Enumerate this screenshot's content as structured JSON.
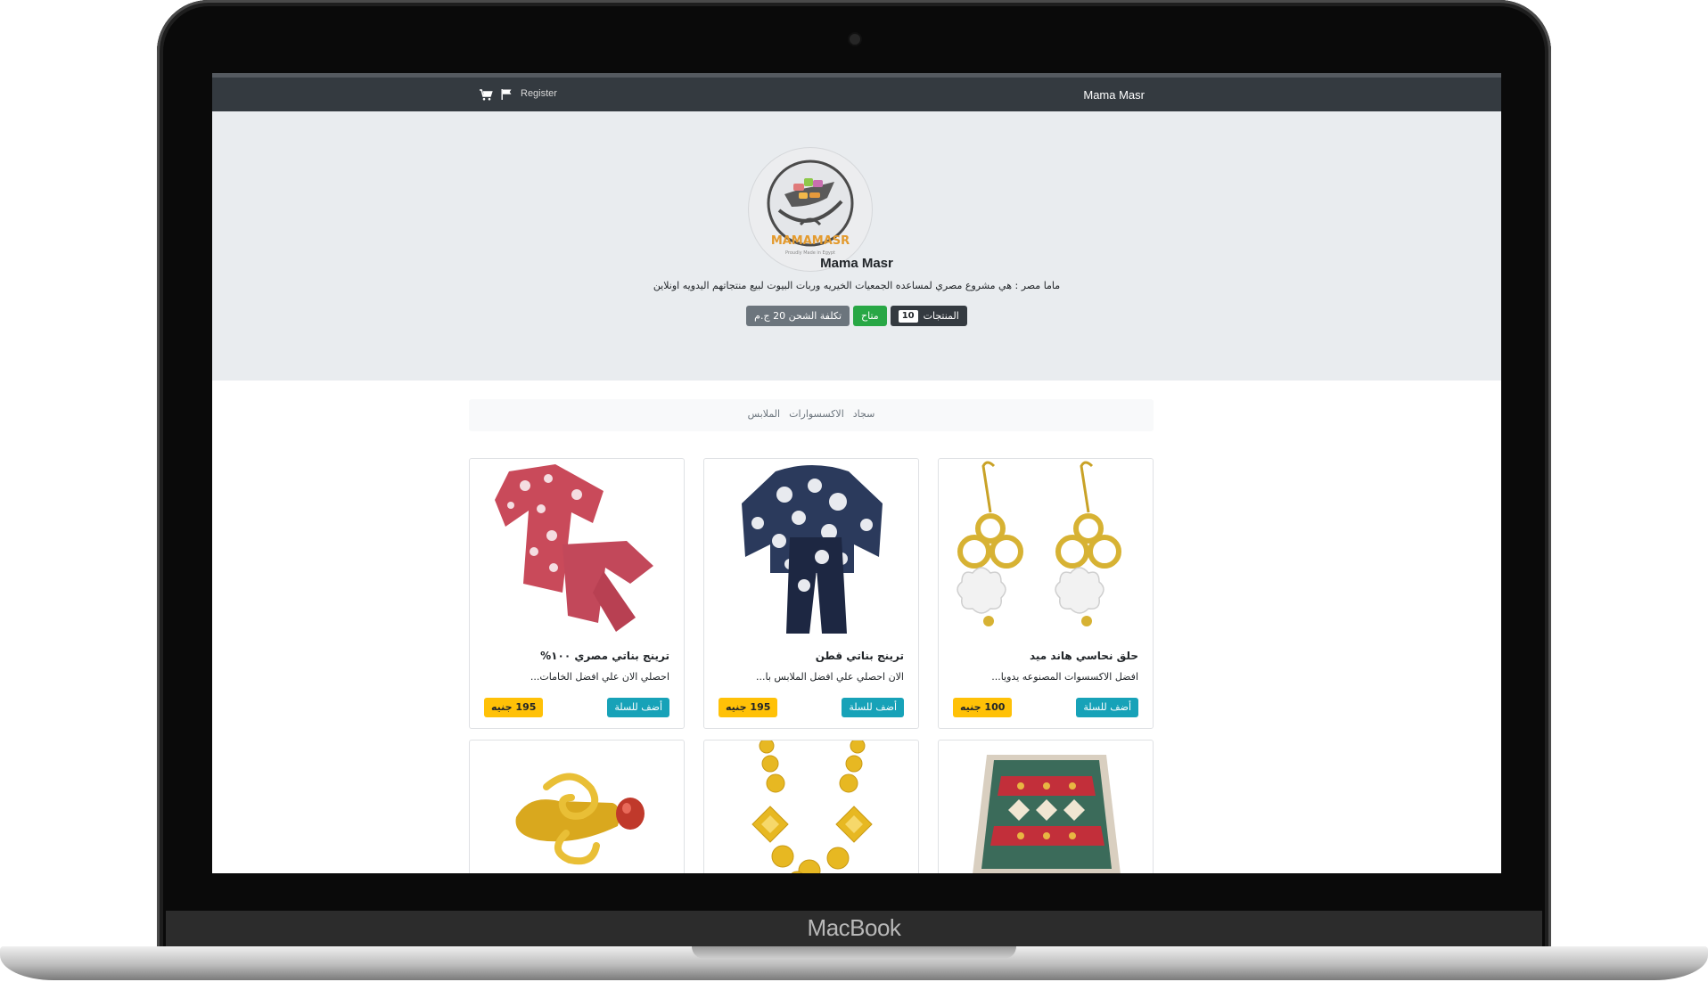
{
  "device": {
    "brand": "MacBook"
  },
  "navbar": {
    "brand": "Mama Masr",
    "register": "Register",
    "icons": [
      "cart-icon",
      "flag-icon"
    ]
  },
  "hero": {
    "logo_text": "MAMAMASR",
    "logo_tagline": "Proudly Made in Egypt",
    "title": "Mama Masr",
    "description": "ماما مصر : هي مشروع مصري لمساعده الجمعيات الخيريه وربات البيوت لبيع منتجاتهم اليدويه اونلاين",
    "badges": {
      "products_label": "المنتجات",
      "products_count": "10",
      "status": "متاح",
      "shipping": "تكلفة الشحن 20 ج.م"
    }
  },
  "categories": [
    "سجاد",
    "الاكسسوارات",
    "الملابس"
  ],
  "products": [
    {
      "title": "حلق نحاسي هاند ميد",
      "desc": "افضل الاكسسوات المصنوعه يدويا...",
      "add": "أضف للسلة",
      "price": "100 جنيه",
      "image": "earrings"
    },
    {
      "title": "ترينج بناتي قطن",
      "desc": "الان احصلي علي افضل الملابس با...",
      "add": "أضف للسلة",
      "price": "195 جنيه",
      "image": "navy-pajama"
    },
    {
      "title": "ترينج بناتي مصري ١٠٠%",
      "desc": "احصلي الان علي افضل الخامات...",
      "add": "أضف للسلة",
      "price": "195 جنيه",
      "image": "pink-pajama"
    },
    {
      "image": "rug"
    },
    {
      "image": "gold-necklace"
    },
    {
      "image": "gold-ring"
    }
  ],
  "colors": {
    "navbar": "#343a40",
    "hero": "#e9ecef",
    "add_button": "#17a2b8",
    "price": "#ffc107",
    "status": "#28a745"
  }
}
